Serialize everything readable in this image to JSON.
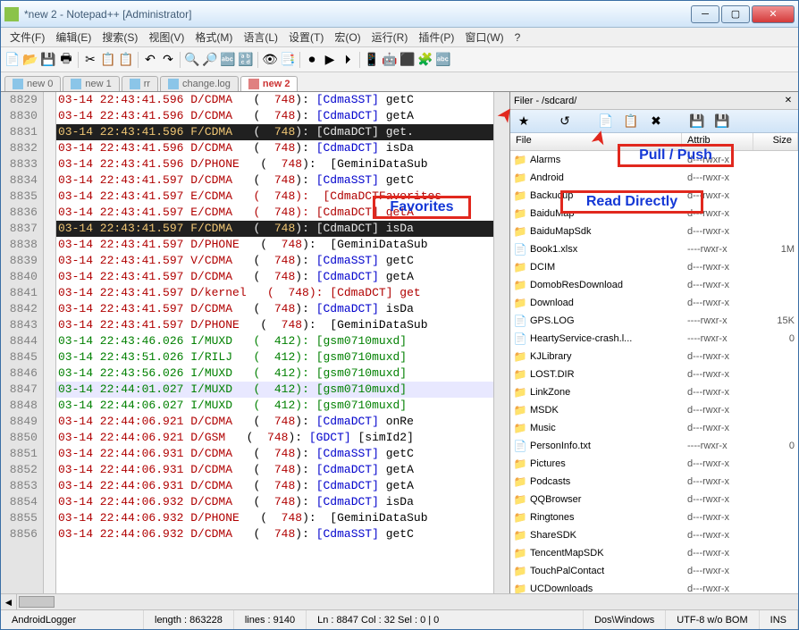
{
  "window": {
    "title": "*new 2 - Notepad++ [Administrator]"
  },
  "menu": [
    "文件(F)",
    "编辑(E)",
    "搜索(S)",
    "视图(V)",
    "格式(M)",
    "语言(L)",
    "设置(T)",
    "宏(O)",
    "运行(R)",
    "插件(P)",
    "窗口(W)",
    "?"
  ],
  "tabs": [
    {
      "label": "new 0",
      "active": false
    },
    {
      "label": "new 1",
      "active": false
    },
    {
      "label": "rr",
      "active": false
    },
    {
      "label": "change.log",
      "active": false
    },
    {
      "label": "new 2",
      "active": true
    }
  ],
  "toolbar_icons": [
    "📄",
    "📂",
    "💾",
    "🖶",
    "✂",
    "📋",
    "📋",
    "↶",
    "↷",
    "🔍",
    "🔎",
    "🔤",
    "🔡",
    "👁",
    "📑",
    "⏺",
    "▶",
    "⏵",
    "📱",
    "🤖",
    "⬛",
    "🧩",
    "🔤"
  ],
  "lines": [
    {
      "n": 8829,
      "cls": "",
      "t": "03-14 22:43:41.596 D/CDMA    (  748): [CdmaSST] getC"
    },
    {
      "n": 8830,
      "cls": "",
      "t": "03-14 22:43:41.596 D/CDMA    (  748): [CdmaDCT] getA"
    },
    {
      "n": 8831,
      "cls": "hl-dark",
      "t": "03-14 22:43:41.596 F/CDMA    (  748): [CdmaDCT] get."
    },
    {
      "n": 8832,
      "cls": "",
      "t": "03-14 22:43:41.596 D/CDMA    (  748): [CdmaDCT] isDa"
    },
    {
      "n": 8833,
      "cls": "",
      "t": "03-14 22:43:41.596 D/PHONE   (  748): [GeminiDataSub"
    },
    {
      "n": 8834,
      "cls": "",
      "t": "03-14 22:43:41.597 D/CDMA    (  748): [CdmaSST] getC"
    },
    {
      "n": 8835,
      "cls": "red",
      "t": "03-14 22:43:41.597 E/CDMA    (  748): [CdmaDCTFavorites"
    },
    {
      "n": 8836,
      "cls": "red",
      "t": "03-14 22:43:41.597 E/CDMA    (  748): [CdmaDCT] getA"
    },
    {
      "n": 8837,
      "cls": "hl-dark",
      "t": "03-14 22:43:41.597 F/CDMA    (  748): [CdmaDCT] isDa"
    },
    {
      "n": 8838,
      "cls": "",
      "t": "03-14 22:43:41.597 D/PHONE   (  748): [GeminiDataSub"
    },
    {
      "n": 8839,
      "cls": "",
      "t": "03-14 22:43:41.597 V/CDMA    (  748): [CdmaSST] getC"
    },
    {
      "n": 8840,
      "cls": "",
      "t": "03-14 22:43:41.597 D/CDMA    (  748): [CdmaDCT] getA"
    },
    {
      "n": 8841,
      "cls": "red",
      "t": "03-14 22:43:41.597 D/kernel  (  748): [CdmaDCT] get"
    },
    {
      "n": 8842,
      "cls": "",
      "t": "03-14 22:43:41.597 D/CDMA    (  748): [CdmaDCT] isDa"
    },
    {
      "n": 8843,
      "cls": "",
      "t": "03-14 22:43:41.597 D/PHONE   (  748): [GeminiDataSub"
    },
    {
      "n": 8844,
      "cls": "green",
      "t": "03-14 22:43:46.026 I/MUXD    (  412): [gsm0710muxd]"
    },
    {
      "n": 8845,
      "cls": "green",
      "t": "03-14 22:43:51.026 I/RILJ    (  412): [gsm0710muxd]"
    },
    {
      "n": 8846,
      "cls": "green",
      "t": "03-14 22:43:56.026 I/MUXD    (  412): [gsm0710muxd]"
    },
    {
      "n": 8847,
      "cls": "green hl-sel",
      "t": "03-14 22:44:01.027 I/MUXD    (  412): [gsm0710muxd]"
    },
    {
      "n": 8848,
      "cls": "green",
      "t": "03-14 22:44:06.027 I/MUXD    (  412): [gsm0710muxd]"
    },
    {
      "n": 8849,
      "cls": "",
      "t": "03-14 22:44:06.921 D/CDMA    (  748): [CdmaDCT] onRe"
    },
    {
      "n": 8850,
      "cls": "",
      "t": "03-14 22:44:06.921 D/GSM     (  748): [GDCT] [simId2]"
    },
    {
      "n": 8851,
      "cls": "",
      "t": "03-14 22:44:06.931 D/CDMA    (  748): [CdmaSST] getC"
    },
    {
      "n": 8852,
      "cls": "",
      "t": "03-14 22:44:06.931 D/CDMA    (  748): [CdmaDCT] getA"
    },
    {
      "n": 8853,
      "cls": "",
      "t": "03-14 22:44:06.931 D/CDMA    (  748): [CdmaDCT] getA"
    },
    {
      "n": 8854,
      "cls": "",
      "t": "03-14 22:44:06.932 D/CDMA    (  748): [CdmaDCT] isDa"
    },
    {
      "n": 8855,
      "cls": "",
      "t": "03-14 22:44:06.932 D/PHONE   (  748): [GeminiDataSub"
    },
    {
      "n": 8856,
      "cls": "",
      "t": "03-14 22:44:06.932 D/CDMA    (  748): [CdmaSST] getC"
    }
  ],
  "filer": {
    "title": "Filer - /sdcard/",
    "toolbar": [
      "★",
      "↺",
      "📄",
      "📋",
      "✖",
      "💾",
      "💾"
    ],
    "cols": {
      "file": "File",
      "attr": "Attrib",
      "size": "Size"
    },
    "files": [
      {
        "n": "Alarms",
        "t": "d",
        "a": "d---rwxr-x",
        "s": ""
      },
      {
        "n": "Android",
        "t": "d",
        "a": "d---rwxr-x",
        "s": ""
      },
      {
        "n": "Backucup",
        "t": "d",
        "a": "d---rwxr-x",
        "s": ""
      },
      {
        "n": "BaiduMap",
        "t": "d",
        "a": "d---rwxr-x",
        "s": ""
      },
      {
        "n": "BaiduMapSdk",
        "t": "d",
        "a": "d---rwxr-x",
        "s": ""
      },
      {
        "n": "Book1.xlsx",
        "t": "f",
        "a": "----rwxr-x",
        "s": "1M"
      },
      {
        "n": "DCIM",
        "t": "d",
        "a": "d---rwxr-x",
        "s": ""
      },
      {
        "n": "DomobResDownload",
        "t": "d",
        "a": "d---rwxr-x",
        "s": ""
      },
      {
        "n": "Download",
        "t": "d",
        "a": "d---rwxr-x",
        "s": ""
      },
      {
        "n": "GPS.LOG",
        "t": "f",
        "a": "----rwxr-x",
        "s": "15K"
      },
      {
        "n": "HeartyService-crash.l...",
        "t": "f",
        "a": "----rwxr-x",
        "s": "0"
      },
      {
        "n": "KJLibrary",
        "t": "d",
        "a": "d---rwxr-x",
        "s": ""
      },
      {
        "n": "LOST.DIR",
        "t": "d",
        "a": "d---rwxr-x",
        "s": ""
      },
      {
        "n": "LinkZone",
        "t": "d",
        "a": "d---rwxr-x",
        "s": ""
      },
      {
        "n": "MSDK",
        "t": "d",
        "a": "d---rwxr-x",
        "s": ""
      },
      {
        "n": "Music",
        "t": "d",
        "a": "d---rwxr-x",
        "s": ""
      },
      {
        "n": "PersonInfo.txt",
        "t": "f",
        "a": "----rwxr-x",
        "s": "0"
      },
      {
        "n": "Pictures",
        "t": "d",
        "a": "d---rwxr-x",
        "s": ""
      },
      {
        "n": "Podcasts",
        "t": "d",
        "a": "d---rwxr-x",
        "s": ""
      },
      {
        "n": "QQBrowser",
        "t": "d",
        "a": "d---rwxr-x",
        "s": ""
      },
      {
        "n": "Ringtones",
        "t": "d",
        "a": "d---rwxr-x",
        "s": ""
      },
      {
        "n": "ShareSDK",
        "t": "d",
        "a": "d---rwxr-x",
        "s": ""
      },
      {
        "n": "TencentMapSDK",
        "t": "d",
        "a": "d---rwxr-x",
        "s": ""
      },
      {
        "n": "TouchPalContact",
        "t": "d",
        "a": "d---rwxr-x",
        "s": ""
      },
      {
        "n": "UCDownloads",
        "t": "d",
        "a": "d---rwxr-x",
        "s": ""
      }
    ]
  },
  "status": {
    "left": "AndroidLogger",
    "length": "length : 863228",
    "lines": "lines : 9140",
    "pos": "Ln : 8847    Col : 32    Sel : 0 | 0",
    "eol": "Dos\\Windows",
    "enc": "UTF-8 w/o BOM",
    "mode": "INS"
  },
  "annot": {
    "fav": "Favorites",
    "read": "Read Directly",
    "pull": "Pull / Push"
  }
}
